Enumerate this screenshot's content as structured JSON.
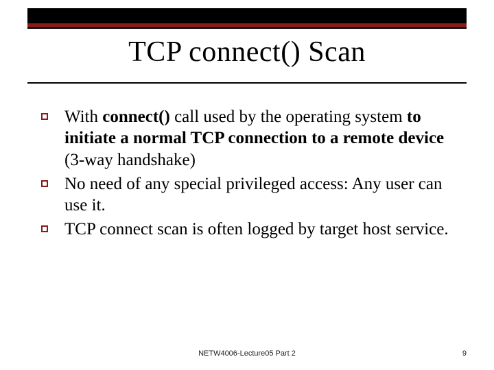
{
  "title": "TCP connect() Scan",
  "bullets": [
    {
      "segments": [
        {
          "text": "With ",
          "bold": false
        },
        {
          "text": "connect()",
          "bold": true
        },
        {
          "text": " call used by the operating system ",
          "bold": false
        },
        {
          "text": "to initiate a normal TCP connection to a remote device",
          "bold": true
        },
        {
          "text": " (3-way handshake)",
          "bold": false
        }
      ]
    },
    {
      "segments": [
        {
          "text": "No need of any special privileged access: Any user can use it.",
          "bold": false
        }
      ]
    },
    {
      "segments": [
        {
          "text": "TCP connect scan is often logged by target host service.",
          "bold": false
        }
      ]
    }
  ],
  "footer_center": "NETW4006-Lecture05 Part 2",
  "footer_right": "9"
}
